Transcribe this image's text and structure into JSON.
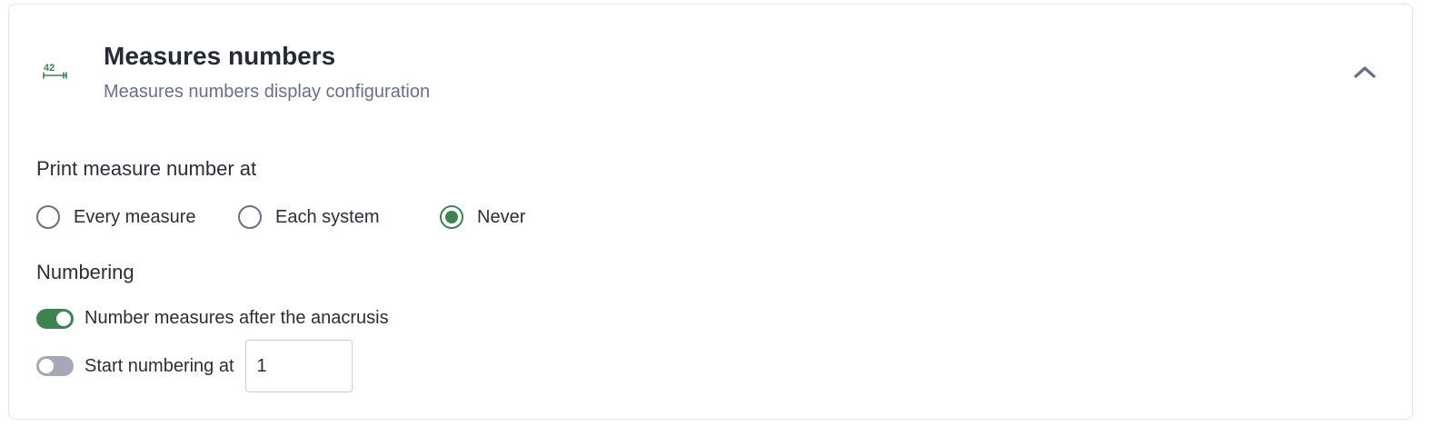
{
  "panel": {
    "icon": "measure-number-icon",
    "icon_label": "42",
    "title": "Measures numbers",
    "subtitle": "Measures numbers display configuration",
    "collapse_icon": "chevron-up-icon"
  },
  "print_at": {
    "label": "Print measure number at",
    "options": [
      {
        "label": "Every measure",
        "checked": false
      },
      {
        "label": "Each system",
        "checked": false
      },
      {
        "label": "Never",
        "checked": true
      }
    ]
  },
  "numbering": {
    "label": "Numbering",
    "after_anacrusis": {
      "label": "Number measures after the anacrusis",
      "enabled": true
    },
    "start_at": {
      "label": "Start numbering at",
      "enabled": false,
      "value": "1"
    }
  },
  "colors": {
    "accent": "#3e8350",
    "toggle_off": "#a3a9b7",
    "radio_border": "#667089"
  }
}
